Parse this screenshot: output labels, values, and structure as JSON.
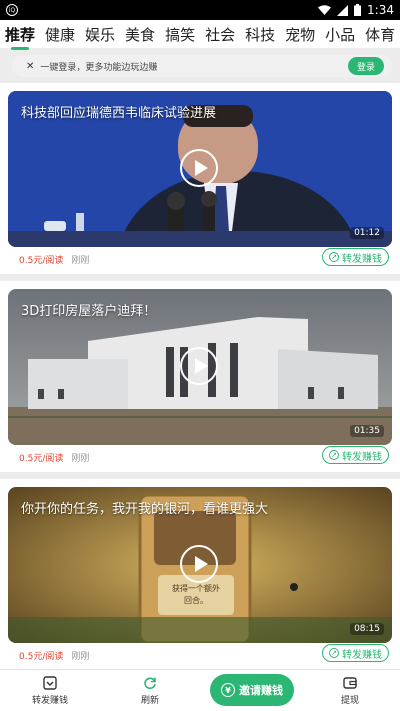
{
  "status_bar": {
    "time": "1:34",
    "app_badge": "iQ"
  },
  "tabs": [
    "推荐",
    "健康",
    "娱乐",
    "美食",
    "搞笑",
    "社会",
    "科技",
    "宠物",
    "小品",
    "体育"
  ],
  "login_bar": {
    "text": "一键登录，更多功能边玩边赚",
    "button": "登录"
  },
  "articles": [
    {
      "title": "科技部回应瑞德西韦临床试验进展",
      "duration": "01:12",
      "price": "0.5元/阅读",
      "time": "刚刚",
      "share": "转发赚钱"
    },
    {
      "title": "3D打印房屋落户迪拜！",
      "duration": "01:35",
      "price": "0.5元/阅读",
      "time": "刚刚",
      "share": "转发赚钱"
    },
    {
      "title": "你开你的任务，我开我的银河，看谁更强大",
      "duration": "08:15",
      "price": "0.5元/阅读",
      "time": "刚刚",
      "share": "转发赚钱"
    }
  ],
  "bottom_nav": {
    "forward": "转发赚钱",
    "refresh": "刷新",
    "invite": "邀请赚钱",
    "withdraw": "提现"
  },
  "colors": {
    "accent": "#2bb673",
    "price": "#e6412e"
  }
}
